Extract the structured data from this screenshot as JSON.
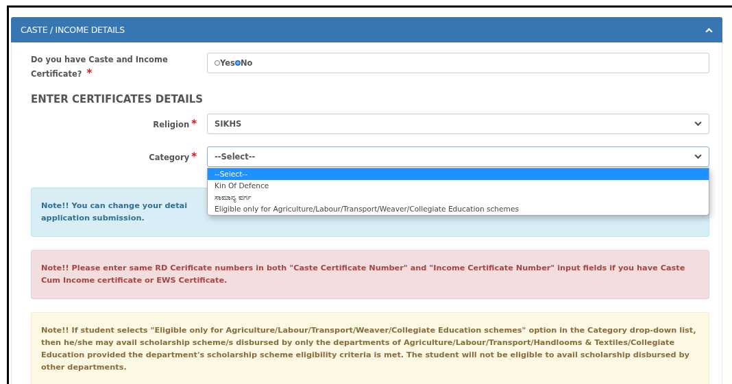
{
  "panel": {
    "title": "CASTE / INCOME DETAILS",
    "expanded": true
  },
  "certificate_question": {
    "label": "Do you have Caste and Income Certificate?",
    "required_mark": "*",
    "options": [
      {
        "label": "Yes",
        "selected": false
      },
      {
        "label": "No",
        "selected": true
      }
    ]
  },
  "section_heading": "ENTER CERTIFICATES DETAILS",
  "fields": [
    {
      "label": "Religion",
      "required_mark": "*",
      "value": "SIKHS",
      "open": false
    },
    {
      "label": "Category",
      "required_mark": "*",
      "value": "--Select--",
      "open": true,
      "options": [
        {
          "label": "--Select--",
          "selected": true
        },
        {
          "label": "Kin Of Defence",
          "selected": false
        },
        {
          "label": "ಸಾಮಾನ್ಯ ವರ್ಗ",
          "selected": false
        },
        {
          "label": "Eligible only for Agriculture/Labour/Transport/Weaver/Collegiate Education schemes",
          "selected": false
        }
      ]
    }
  ],
  "notes": [
    {
      "kind": "info",
      "lines": [
        "Note!! You can change your detai",
        "application submission."
      ]
    },
    {
      "kind": "danger",
      "lines": [
        "Note!! Please enter same RD Cerificate numbers in both \"Caste Certificate Number\" and \"Income Certificate Number\" input fields if you have Caste Cum Income certificate or EWS Certificate."
      ]
    },
    {
      "kind": "warning",
      "lines": [
        "Note!! If student selects \"Eligible only for Agriculture/Labour/Transport/Weaver/Collegiate Education schemes\" option in the Category drop-down list, then he/she may avail scholarship scheme/s disbursed by only the departments of Agriculture/Labour/Transport/Handlooms & Textiles/Collegiate Education provided the department's scholarship scheme eligibility criteria is met. The student will not be eligible to avail scholarship disbursed by other departments."
      ]
    }
  ]
}
